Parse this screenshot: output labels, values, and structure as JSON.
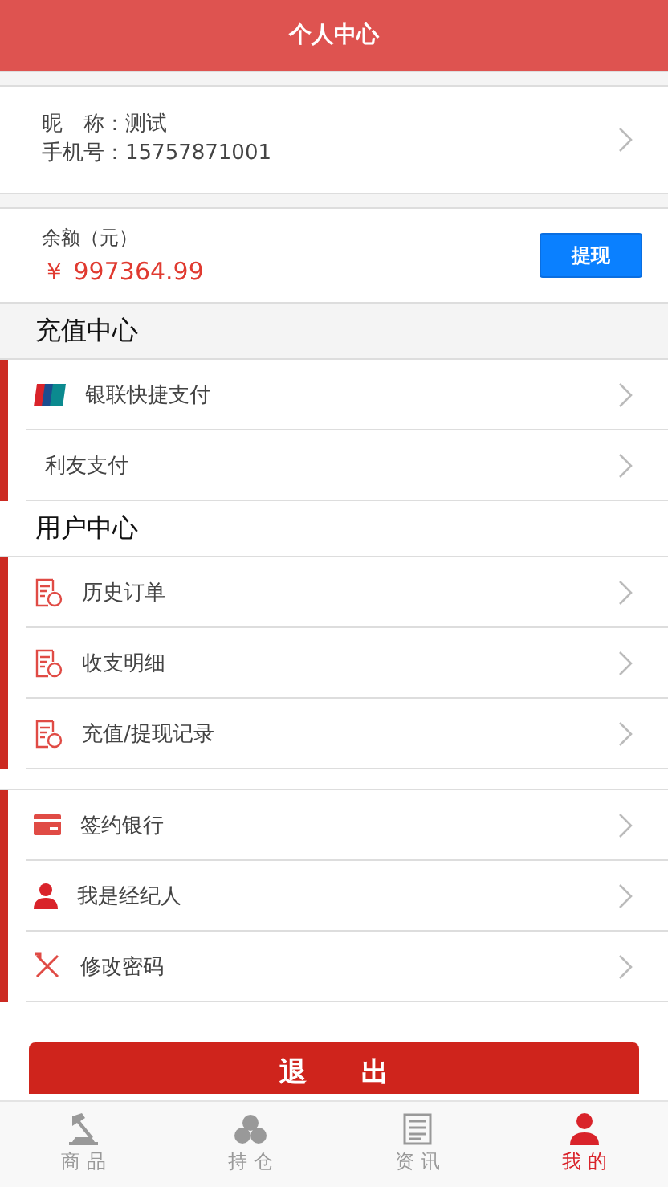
{
  "header": {
    "title": "个人中心"
  },
  "profile": {
    "nickname_label": "昵　称：",
    "nickname": "测试",
    "phone_label": "手机号：",
    "phone": "15757871001"
  },
  "balance": {
    "label": "余额（元）",
    "amount": "￥ 997364.99",
    "button": "提现"
  },
  "sections": [
    {
      "title": "充值中心",
      "kind": "band",
      "items": [
        {
          "label": "银联快捷支付",
          "kind": "icon"
        },
        {
          "label": "利友支付",
          "kind": "plain"
        }
      ]
    },
    {
      "title": "用户中心",
      "kind": "plain",
      "items": [
        {
          "label": "历史订单",
          "kind": "icon"
        },
        {
          "label": "收支明细",
          "kind": "icon"
        },
        {
          "label": "充值/提现记录",
          "kind": "icon"
        }
      ]
    },
    {
      "items": [
        {
          "label": "签约银行",
          "kind": "icon"
        },
        {
          "label": "我是经纪人",
          "kind": "icon"
        },
        {
          "label": "修改密码",
          "kind": "icon"
        }
      ]
    }
  ],
  "logout": "退　　出",
  "tabs": [
    {
      "label": "商 品",
      "selected": false
    },
    {
      "label": "持 仓",
      "selected": false
    },
    {
      "label": "资 讯",
      "selected": false
    },
    {
      "label": "我 的",
      "selected": true
    }
  ]
}
